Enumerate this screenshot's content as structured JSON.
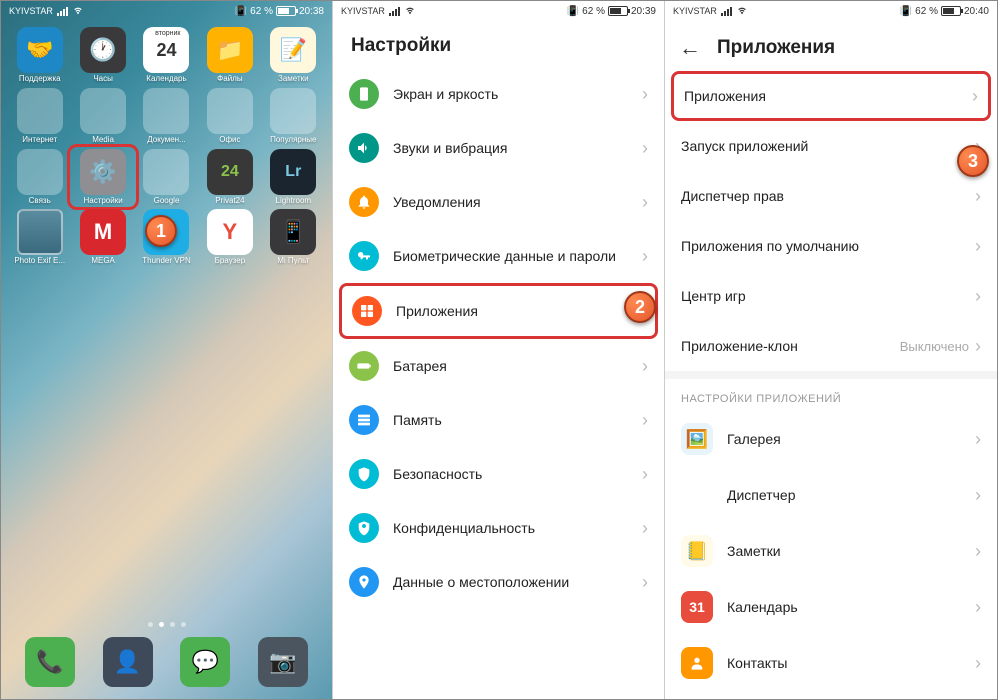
{
  "phone1": {
    "status": {
      "carrier": "KYIVSTAR",
      "battery": "62 %",
      "time": "20:38",
      "vibrate_icon": "vibrate"
    },
    "calendar_badge": {
      "weekday": "вторник",
      "day": "24"
    },
    "apps_row1": [
      {
        "label": "Поддержка",
        "color": "#1e88c7"
      },
      {
        "label": "Часы",
        "color": "#3a3a3c"
      },
      {
        "label": "Календарь",
        "color": "#ffffff"
      },
      {
        "label": "Файлы",
        "color": "#ffb300"
      },
      {
        "label": "Заметки",
        "color": "#fff8dc"
      }
    ],
    "apps_row2": [
      {
        "label": "Интернет",
        "folder": true
      },
      {
        "label": "Media",
        "folder": true
      },
      {
        "label": "Докумен...",
        "folder": true
      },
      {
        "label": "Офис",
        "folder": true
      },
      {
        "label": "Популярные",
        "folder": true
      }
    ],
    "apps_row3": [
      {
        "label": "Связь",
        "folder": true
      },
      {
        "label": "Настройки",
        "color": "#8e8e93",
        "highlight": true
      },
      {
        "label": "Google",
        "folder": true
      },
      {
        "label": "Privat24",
        "color": "#383838",
        "text": "24"
      },
      {
        "label": "Lightroom",
        "color": "#1a2530",
        "text": "Lr"
      }
    ],
    "apps_row4": [
      {
        "label": "Photo Exif E...",
        "widget": true
      },
      {
        "label": "MEGA",
        "color": "#d9272e",
        "text": "M"
      },
      {
        "label": "Thunder VPN",
        "color": "#1eaee5"
      },
      {
        "label": "Браузер",
        "color": "#fff"
      },
      {
        "label": "Mi Пульт",
        "color": "#38383a"
      }
    ],
    "dock": [
      {
        "name": "phone",
        "color": "#4caf50"
      },
      {
        "name": "contacts",
        "color": "#3e4a5a"
      },
      {
        "name": "messages",
        "color": "#4caf50"
      },
      {
        "name": "camera",
        "color": "#4a5560"
      }
    ],
    "badge": "1"
  },
  "phone2": {
    "status": {
      "carrier": "KYIVSTAR",
      "battery": "62 %",
      "time": "20:39"
    },
    "title": "Настройки",
    "items": [
      {
        "label": "Экран и яркость",
        "icon": "display",
        "bg": "bg-green"
      },
      {
        "label": "Звуки и вибрация",
        "icon": "sound",
        "bg": "bg-teal"
      },
      {
        "label": "Уведомления",
        "icon": "bell",
        "bg": "bg-orange"
      },
      {
        "label": "Биометрические данные и пароли",
        "icon": "key",
        "bg": "bg-cyan"
      },
      {
        "label": "Приложения",
        "icon": "apps",
        "bg": "bg-deeporange",
        "highlight": true
      },
      {
        "label": "Батарея",
        "icon": "battery",
        "bg": "bg-lime"
      },
      {
        "label": "Память",
        "icon": "storage",
        "bg": "bg-blue"
      },
      {
        "label": "Безопасность",
        "icon": "shield",
        "bg": "bg-cyan"
      },
      {
        "label": "Конфиденциальность",
        "icon": "privacy",
        "bg": "bg-cyan"
      },
      {
        "label": "Данные о местоположении",
        "icon": "location",
        "bg": "bg-blue"
      }
    ],
    "badge": "2"
  },
  "phone3": {
    "status": {
      "carrier": "KYIVSTAR",
      "battery": "62 %",
      "time": "20:40"
    },
    "title": "Приложения",
    "items_top": [
      {
        "label": "Приложения",
        "highlight": true
      },
      {
        "label": "Запуск приложений"
      },
      {
        "label": "Диспетчер прав"
      },
      {
        "label": "Приложения по умолчанию"
      },
      {
        "label": "Центр игр"
      },
      {
        "label": "Приложение-клон",
        "value": "Выключено"
      }
    ],
    "section": "НАСТРОЙКИ ПРИЛОЖЕНИЙ",
    "items_apps": [
      {
        "label": "Галерея",
        "icon_bg": "#7ec8e3"
      },
      {
        "label": "Диспетчер",
        "icon_bg": "#4db8e8"
      },
      {
        "label": "Заметки",
        "icon_bg": "#ffe28a"
      },
      {
        "label": "Календарь",
        "icon_bg": "#e74c3c",
        "text": "31"
      },
      {
        "label": "Контакты",
        "icon_bg": "#ff9800"
      }
    ],
    "badge": "3"
  }
}
